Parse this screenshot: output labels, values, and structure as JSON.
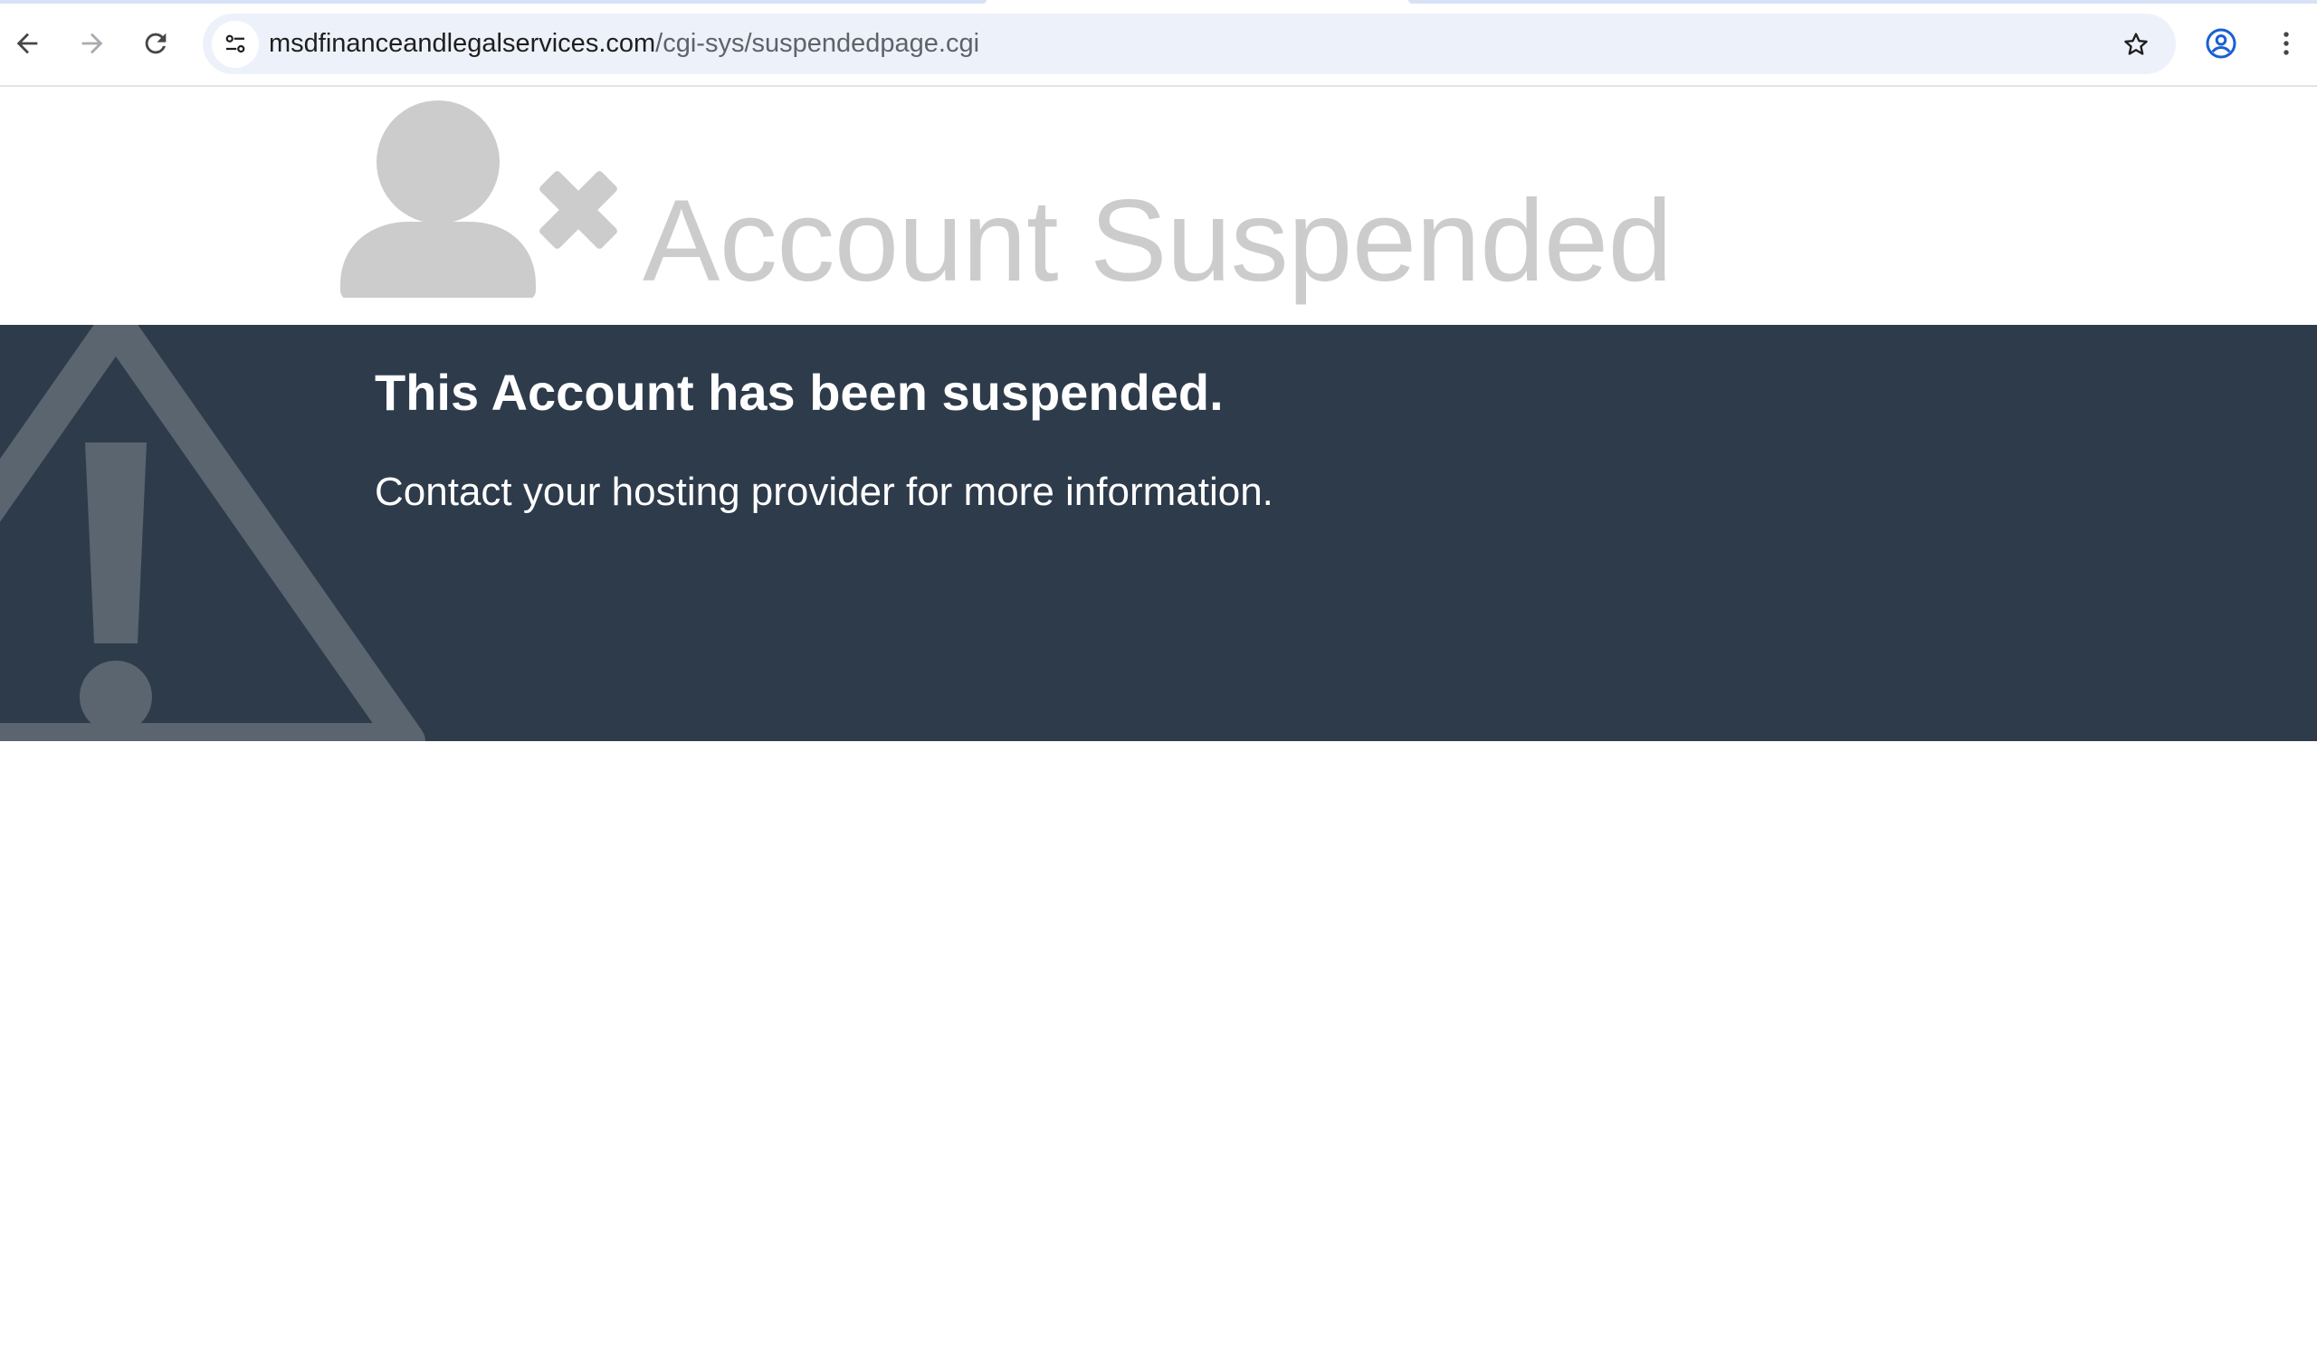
{
  "browser": {
    "url_host": "msdfinanceandlegalservices.com",
    "url_path": "/cgi-sys/suspendedpage.cgi",
    "icons": {
      "back": "arrow-back-icon",
      "forward": "arrow-forward-icon",
      "reload": "reload-icon",
      "site_info": "tune-icon",
      "bookmark": "star-icon",
      "profile": "account-circle-icon",
      "menu": "more-vertical-icon"
    }
  },
  "page": {
    "title": "Account Suspended",
    "heading": "This Account has been suspended.",
    "message": "Contact your hosting provider for more information.",
    "colors": {
      "banner_bg": "#2e3b4b",
      "title_gray": "#cccccc",
      "warning_gray": "#5a6570"
    }
  }
}
